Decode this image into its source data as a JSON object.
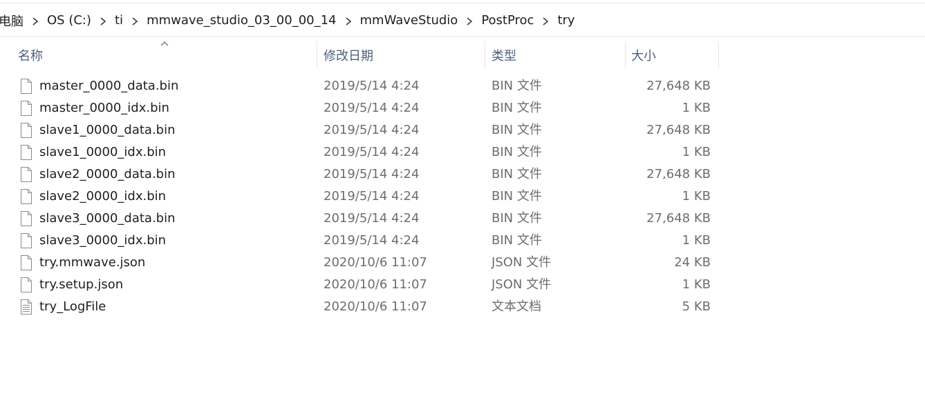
{
  "breadcrumb": {
    "items": [
      "电脑",
      "OS (C:)",
      "ti",
      "mmwave_studio_03_00_00_14",
      "mmWaveStudio",
      "PostProc",
      "try"
    ]
  },
  "columns": {
    "name": "名称",
    "date": "修改日期",
    "type": "类型",
    "size": "大小"
  },
  "files": [
    {
      "name": "master_0000_data.bin",
      "date": "2019/5/14 4:24",
      "type": "BIN 文件",
      "size": "27,648 KB",
      "icon": "blank-file-icon"
    },
    {
      "name": "master_0000_idx.bin",
      "date": "2019/5/14 4:24",
      "type": "BIN 文件",
      "size": "1 KB",
      "icon": "blank-file-icon"
    },
    {
      "name": "slave1_0000_data.bin",
      "date": "2019/5/14 4:24",
      "type": "BIN 文件",
      "size": "27,648 KB",
      "icon": "blank-file-icon"
    },
    {
      "name": "slave1_0000_idx.bin",
      "date": "2019/5/14 4:24",
      "type": "BIN 文件",
      "size": "1 KB",
      "icon": "blank-file-icon"
    },
    {
      "name": "slave2_0000_data.bin",
      "date": "2019/5/14 4:24",
      "type": "BIN 文件",
      "size": "27,648 KB",
      "icon": "blank-file-icon"
    },
    {
      "name": "slave2_0000_idx.bin",
      "date": "2019/5/14 4:24",
      "type": "BIN 文件",
      "size": "1 KB",
      "icon": "blank-file-icon"
    },
    {
      "name": "slave3_0000_data.bin",
      "date": "2019/5/14 4:24",
      "type": "BIN 文件",
      "size": "27,648 KB",
      "icon": "blank-file-icon"
    },
    {
      "name": "slave3_0000_idx.bin",
      "date": "2019/5/14 4:24",
      "type": "BIN 文件",
      "size": "1 KB",
      "icon": "blank-file-icon"
    },
    {
      "name": "try.mmwave.json",
      "date": "2020/10/6 11:07",
      "type": "JSON 文件",
      "size": "24 KB",
      "icon": "blank-file-icon"
    },
    {
      "name": "try.setup.json",
      "date": "2020/10/6 11:07",
      "type": "JSON 文件",
      "size": "1 KB",
      "icon": "blank-file-icon"
    },
    {
      "name": "try_LogFile",
      "date": "2020/10/6 11:07",
      "type": "文本文档",
      "size": "5 KB",
      "icon": "text-file-icon"
    }
  ]
}
